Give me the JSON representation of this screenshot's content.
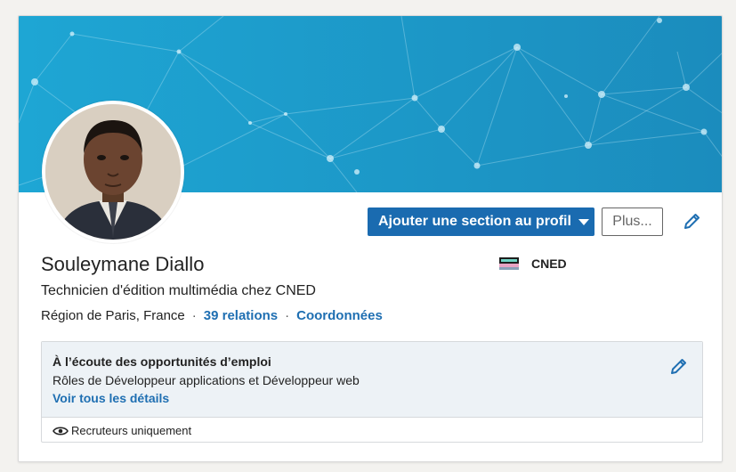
{
  "profile": {
    "name": "Souleymane Diallo",
    "headline": "Technicien d'édition multimédia chez CNED",
    "location": "Région de Paris, France",
    "relations": "39 relations",
    "contact": "Coordonnées",
    "separator": "·"
  },
  "actions": {
    "add_section": "Ajouter une section au profil",
    "more": "Plus..."
  },
  "company": {
    "name": "CNED",
    "logo_icon": "cned-logo"
  },
  "opportunities": {
    "title": "À l’écoute des opportunités d’emploi",
    "roles": "Rôles de Développeur applications et Développeur web",
    "details_link": "Voir tous les détails",
    "visibility": "Recruteurs uniquement"
  },
  "colors": {
    "banner_start": "#1aa3d2",
    "banner_end": "#1a8ab8",
    "primary_button": "#1a6bb0",
    "link": "#1f6fb2"
  }
}
